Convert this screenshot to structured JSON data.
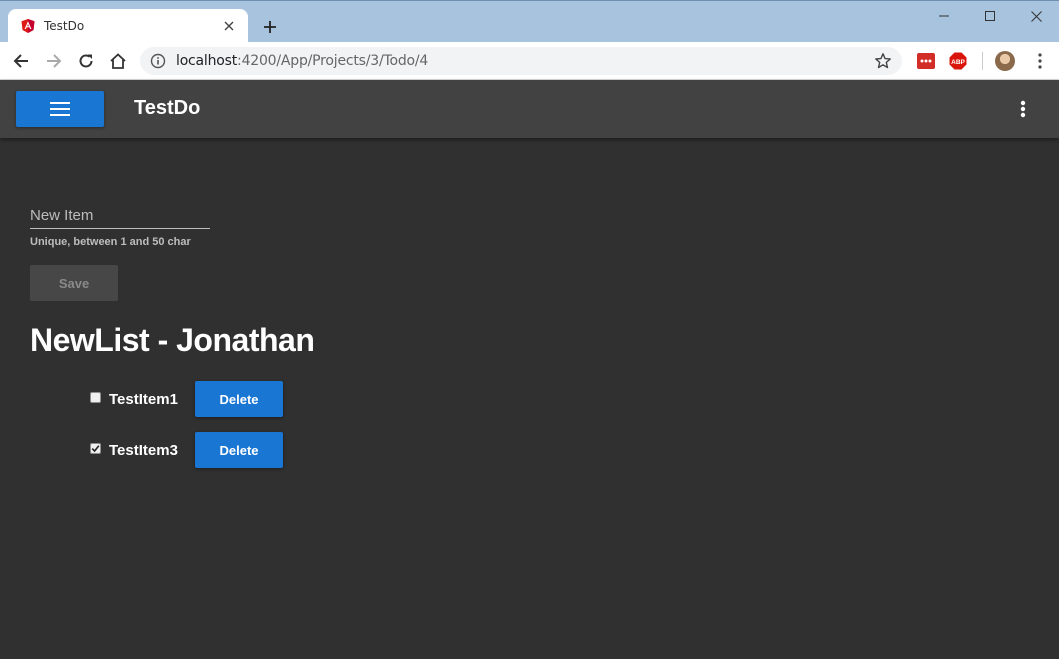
{
  "browser": {
    "tab_title": "TestDo",
    "url_host": "localhost",
    "url_path": ":4200/App/Projects/3/Todo/4",
    "extensions": [
      "lastpass-icon",
      "adblock-icon"
    ],
    "abp_label": "ABP"
  },
  "app": {
    "title": "TestDo",
    "accent_color": "#1976d2",
    "background_color": "#303030"
  },
  "form": {
    "input_placeholder": "New Item",
    "input_value": "",
    "hint": "Unique, between 1 and 50 char",
    "save_label": "Save"
  },
  "list": {
    "title": "NewList - Jonathan",
    "items": [
      {
        "label": "TestItem1",
        "checked": false,
        "delete_label": "Delete"
      },
      {
        "label": "TestItem3",
        "checked": true,
        "delete_label": "Delete"
      }
    ]
  }
}
